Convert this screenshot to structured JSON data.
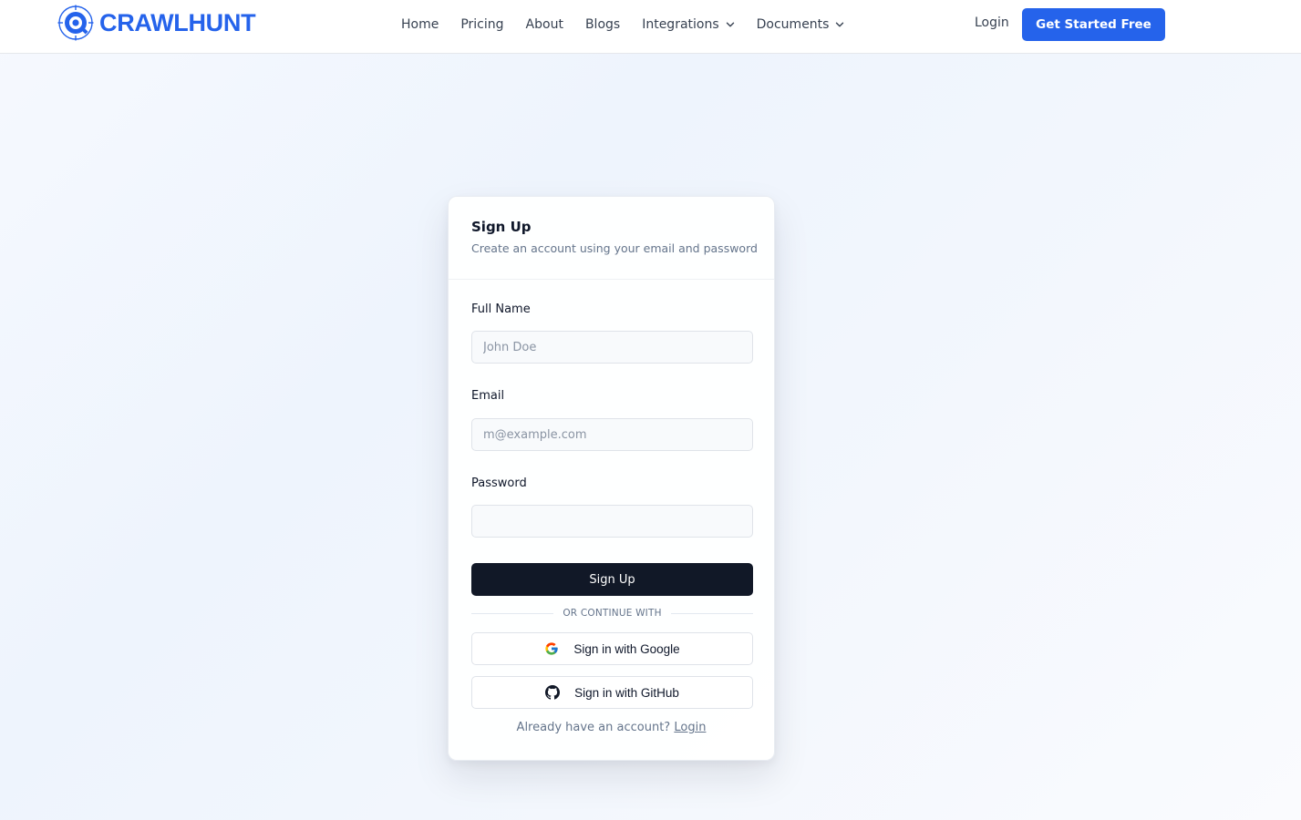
{
  "header": {
    "brand": "CRAWLHUNT",
    "nav": [
      {
        "label": "Home",
        "icon": ""
      },
      {
        "label": "Pricing",
        "icon": ""
      },
      {
        "label": "About",
        "icon": ""
      },
      {
        "label": "Blogs",
        "icon": ""
      },
      {
        "label": "Integrations",
        "icon": "chevron-down-icon"
      },
      {
        "label": "Documents",
        "icon": "chevron-down-icon"
      }
    ],
    "login_label": "Login",
    "cta_label": "Get Started Free"
  },
  "form": {
    "title": "Sign Up",
    "subtitle": "Create an account using your email and password",
    "fields": {
      "full_name": {
        "label": "Full Name",
        "placeholder": "John Doe",
        "value": ""
      },
      "email": {
        "label": "Email",
        "placeholder": "m@example.com",
        "value": ""
      },
      "password": {
        "label": "Password",
        "placeholder": "",
        "value": ""
      }
    },
    "submit_label": "Sign Up",
    "divider_text": "OR CONTINUE WITH",
    "google_label": "Sign in with Google",
    "github_label": "Sign in with GitHub",
    "already_text": "Already have an account?",
    "login_link": "Login"
  },
  "colors": {
    "brand": "#2563eb",
    "primary_button": "#111827",
    "muted_text": "#64748b"
  }
}
